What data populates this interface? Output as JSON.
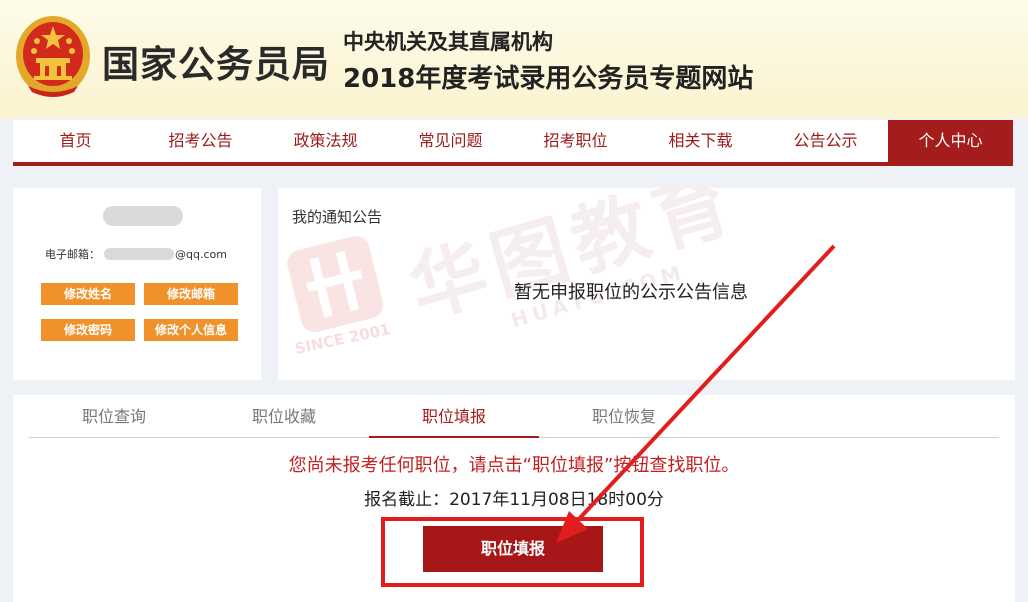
{
  "header": {
    "agency_title": "国家公务员局",
    "site_line1": "中央机关及其直属机构",
    "site_line2": "2018年度考试录用公务员专题网站"
  },
  "nav": {
    "items": [
      "首页",
      "招考公告",
      "政策法规",
      "常见问题",
      "招考职位",
      "相关下载",
      "公告公示",
      "个人中心"
    ],
    "active_index": 7
  },
  "profile": {
    "email_label": "电子邮箱：",
    "email_suffix": "@qq.com",
    "buttons": [
      "修改姓名",
      "修改邮箱",
      "修改密码",
      "修改个人信息"
    ]
  },
  "notice": {
    "title": "我的通知公告",
    "empty_message": "暂无申报职位的公示公告信息"
  },
  "watermark": {
    "brand_text": "华图教育",
    "url": "HUATU.COM",
    "since": "SINCE 2001"
  },
  "positions": {
    "tabs": [
      "职位查询",
      "职位收藏",
      "职位填报",
      "职位恢复"
    ],
    "active_tab": 2,
    "message": "您尚未报考任何职位，请点击“职位填报”按钮查找职位。",
    "deadline": "报名截止：2017年11月08日18时00分",
    "primary_button": "职位填报"
  },
  "colors": {
    "brand_red": "#a51c1c",
    "accent_orange": "#f0912a",
    "highlight": "#e21d1d"
  }
}
